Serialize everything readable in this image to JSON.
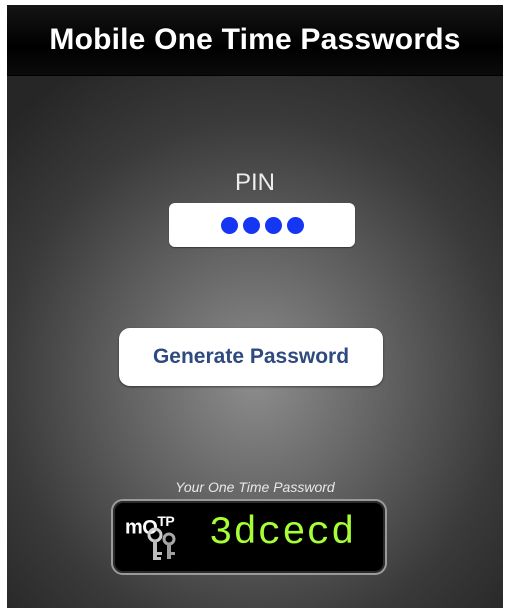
{
  "app": {
    "title": "Mobile One Time Passwords"
  },
  "pin": {
    "label": "PIN",
    "masked_length": 4,
    "dot_color": "#1536f2"
  },
  "generate_button": {
    "label": "Generate Password"
  },
  "otp": {
    "caption": "Your One Time Password",
    "logo_text": "mOTP",
    "value": "3dcecd",
    "value_color": "#a6ff36"
  }
}
